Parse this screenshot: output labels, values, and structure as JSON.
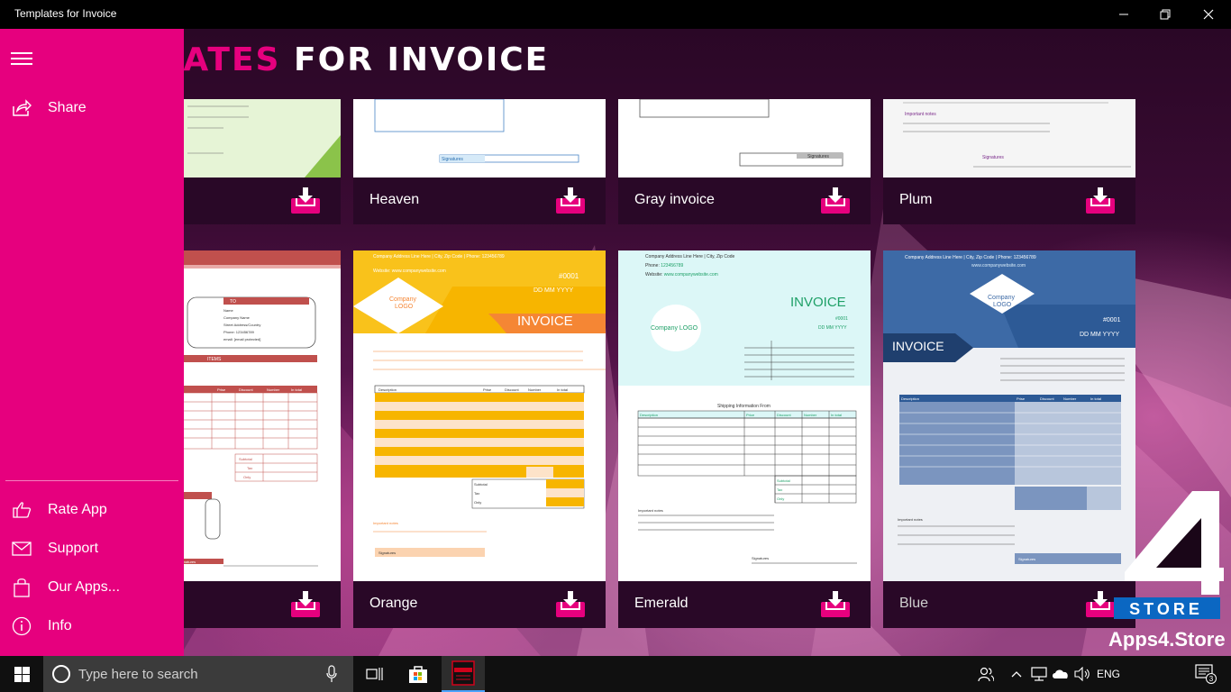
{
  "window": {
    "title": "Templates for Invoice",
    "controls": [
      "minimize",
      "maximize",
      "close"
    ]
  },
  "heading": {
    "pink_part": "PLATES",
    "white_part": "FOR INVOICE"
  },
  "menu": {
    "items_top": [
      {
        "label": "Share",
        "icon": "share-icon"
      }
    ],
    "items_bottom": [
      {
        "label": "Rate App",
        "icon": "rate-icon"
      },
      {
        "label": "Support",
        "icon": "mail-icon"
      },
      {
        "label": "Our Apps...",
        "icon": "shopping-bag-icon"
      },
      {
        "label": "Info",
        "icon": "info-icon"
      }
    ]
  },
  "templates": {
    "row1": [
      {
        "name": ""
      },
      {
        "name": "Heaven"
      },
      {
        "name": "Gray invoice"
      },
      {
        "name": "Plum"
      }
    ],
    "row2": [
      {
        "name": ""
      },
      {
        "name": "Orange"
      },
      {
        "name": "Emerald"
      },
      {
        "name": "Blue"
      }
    ]
  },
  "thumbs": {
    "signatures": "Signatures",
    "important_notes": "Important notes",
    "to": "TO",
    "items": "ITEMS",
    "invoice": "INVOICE",
    "company_logo": "Company LOGO",
    "company_logo_short": "Company\nLOGO",
    "number": "#0001",
    "date": "DD MM YYYY",
    "address_line": "Company Address Line Here | City, Zip Code | Phone: 123456789",
    "address_line_short": "Company Address Line Here | City, Zip Code",
    "website": "Website: www.companywebsite.com",
    "website_blue": "www.companywebsite.com",
    "shipping_info": "Shipping Information From",
    "columns": [
      "Description",
      "Price",
      "Discount",
      "Number",
      "In total"
    ],
    "totals": [
      "Subtotal",
      "Tax",
      "Only"
    ],
    "left_cols": [
      "Prise",
      "Discount",
      "Number",
      "In total"
    ],
    "to_lines": [
      "Name",
      "Company Name",
      "Street Address/Country",
      "Phone: 123456789",
      "email: [email protected]"
    ]
  },
  "watermark": {
    "badge": "STORE",
    "site": "Apps4.Store"
  },
  "taskbar": {
    "search_placeholder": "Type here to search",
    "language": "ENG",
    "notification_count": "3"
  }
}
